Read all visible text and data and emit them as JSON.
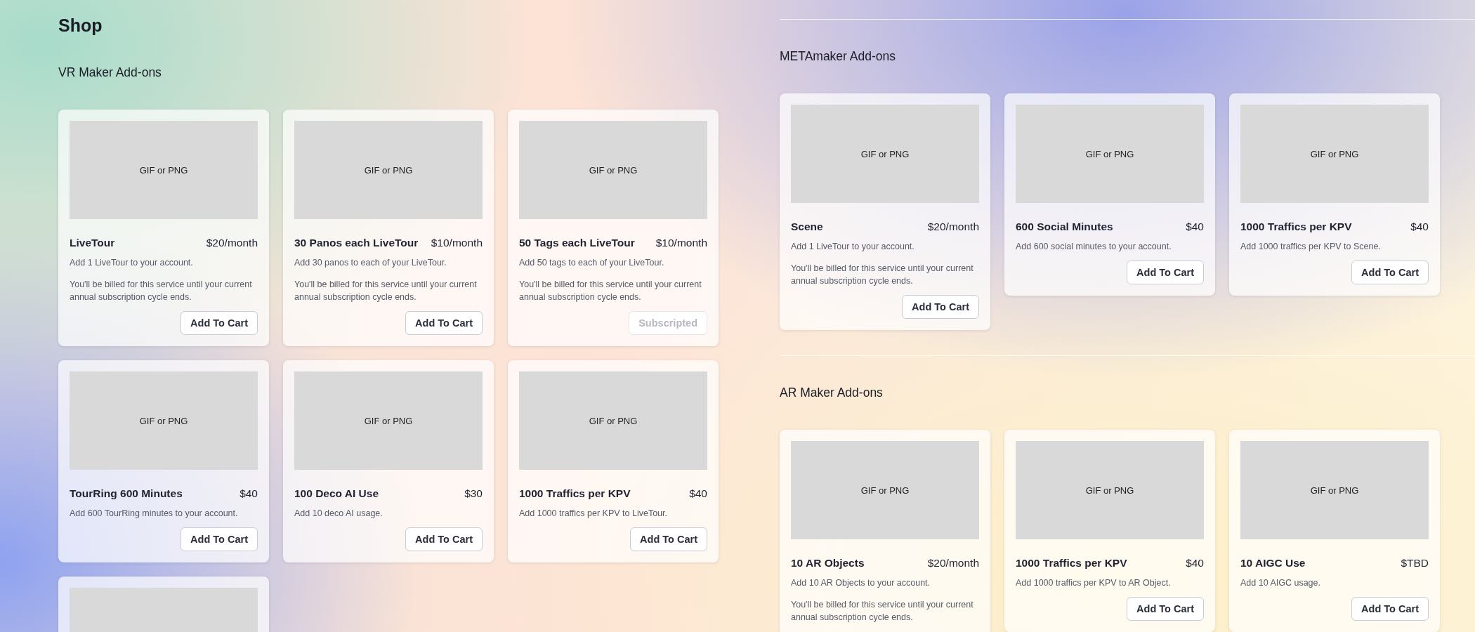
{
  "page": {
    "title": "Shop"
  },
  "left_column": {
    "sections": [
      {
        "title": "VR Maker Add-ons",
        "items": [
          {
            "kind": "full",
            "image_label": "GIF or PNG",
            "name": "LiveTour",
            "price": "$20/month",
            "description": "Add 1 LiveTour to your account.",
            "note": "You'll be billed for this service until your current annual subscription cycle ends.",
            "button": {
              "label": "Add To Cart",
              "disabled": false
            }
          },
          {
            "kind": "full",
            "image_label": "GIF or PNG",
            "name": "30 Panos each LiveTour",
            "price": "$10/month",
            "description": "Add 30 panos to each of your LiveTour.",
            "note": "You'll be billed for this service until your current annual subscription cycle ends.",
            "button": {
              "label": "Add To Cart",
              "disabled": false
            }
          },
          {
            "kind": "full",
            "image_label": "GIF or PNG",
            "name": "50 Tags each LiveTour",
            "price": "$10/month",
            "description": "Add 50 tags to each of your LiveTour.",
            "note": "You'll be billed for this service until your current annual subscription cycle ends.",
            "button": {
              "label": "Subscripted",
              "disabled": true
            }
          },
          {
            "kind": "full",
            "image_label": "GIF or PNG",
            "name": "TourRing 600 Minutes",
            "price": "$40",
            "description": "Add 600 TourRing minutes to your account.",
            "button": {
              "label": "Add To Cart",
              "disabled": false
            }
          },
          {
            "kind": "full",
            "image_label": "GIF or PNG",
            "name": "100 Deco AI Use",
            "price": "$30",
            "description": "Add 10 deco AI usage.",
            "button": {
              "label": "Add To Cart",
              "disabled": false
            }
          },
          {
            "kind": "full",
            "image_label": "GIF or PNG",
            "name": "1000 Traffics per KPV",
            "price": "$40",
            "description": "Add 1000 traffics per KPV to LiveTour.",
            "button": {
              "label": "Add To Cart",
              "disabled": false
            }
          },
          {
            "kind": "image_only"
          }
        ]
      }
    ]
  },
  "right_column": {
    "sections": [
      {
        "title": "METAmaker Add-ons",
        "items": [
          {
            "kind": "full",
            "image_label": "GIF or PNG",
            "name": "Scene",
            "price": "$20/month",
            "description": "Add 1 LiveTour to your account.",
            "note": "You'll be billed for this service until your current annual subscription cycle ends.",
            "button": {
              "label": "Add To Cart",
              "disabled": false
            }
          },
          {
            "kind": "full",
            "image_label": "GIF or PNG",
            "name": "600 Social Minutes",
            "price": "$40",
            "description": "Add 600 social minutes to your account.",
            "button": {
              "label": "Add To Cart",
              "disabled": false
            }
          },
          {
            "kind": "full",
            "image_label": "GIF or PNG",
            "name": "1000 Traffics per KPV",
            "price": "$40",
            "description": "Add 1000 traffics per KPV to Scene.",
            "button": {
              "label": "Add To Cart",
              "disabled": false
            }
          }
        ]
      },
      {
        "title": "AR Maker Add-ons",
        "items": [
          {
            "kind": "full",
            "image_label": "GIF or PNG",
            "name": "10 AR Objects",
            "price": "$20/month",
            "description": "Add 10 AR Objects to your account.",
            "note": "You'll be billed for this service until your current annual subscription cycle ends."
          },
          {
            "kind": "full",
            "image_label": "GIF or PNG",
            "name": "1000 Traffics per KPV",
            "price": "$40",
            "description": "Add 1000 traffics per KPV to AR Object.",
            "button": {
              "label": "Add To Cart",
              "disabled": false
            }
          },
          {
            "kind": "full",
            "image_label": "GIF or PNG",
            "name": "10 AIGC Use",
            "price": "$TBD",
            "description": "Add 10 AIGC usage.",
            "button": {
              "label": "Add To Cart",
              "disabled": false
            }
          }
        ]
      }
    ]
  }
}
